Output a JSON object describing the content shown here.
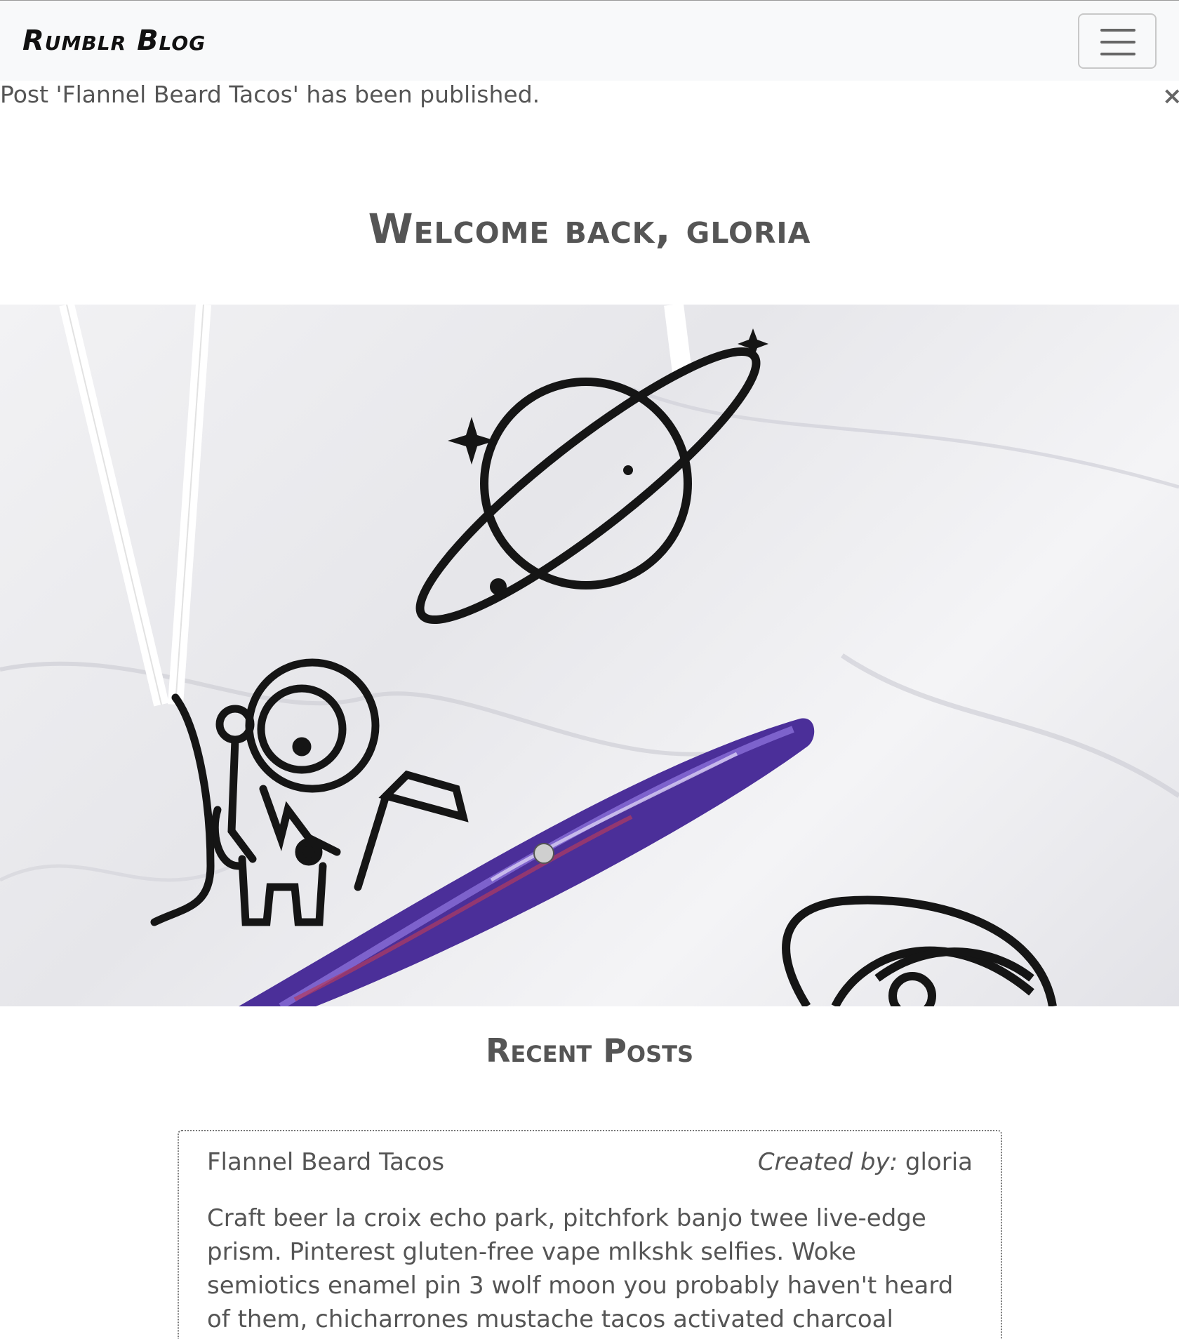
{
  "navbar": {
    "brand": "Rumblr Blog",
    "menu_icon": "hamburger-menu-icon"
  },
  "flash": {
    "message": "Post 'Flannel Beard Tacos' has been published.",
    "close_symbol": "×"
  },
  "welcome": {
    "heading": "Welcome back, gloria"
  },
  "hero": {
    "description_icons": [
      "astronaut-icon",
      "planet-icon",
      "pen-icon",
      "planet-icon"
    ]
  },
  "recent_posts": {
    "heading": "Recent Posts",
    "posts": [
      {
        "title": "Flannel Beard Tacos",
        "created_by_label": "Created by:",
        "author": "gloria",
        "body": "Craft beer la croix echo park, pitchfork banjo twee live-edge prism. Pinterest gluten-free vape mlkshk selfies. Woke semiotics enamel pin 3 wolf moon you probably haven't heard of them, chicharrones mustache tacos activated charcoal single-origin coffee thundercats cronut quinoa"
      }
    ]
  },
  "colors": {
    "navbar_bg": "#f8f9fa",
    "text": "#555555",
    "brand": "#111111"
  }
}
